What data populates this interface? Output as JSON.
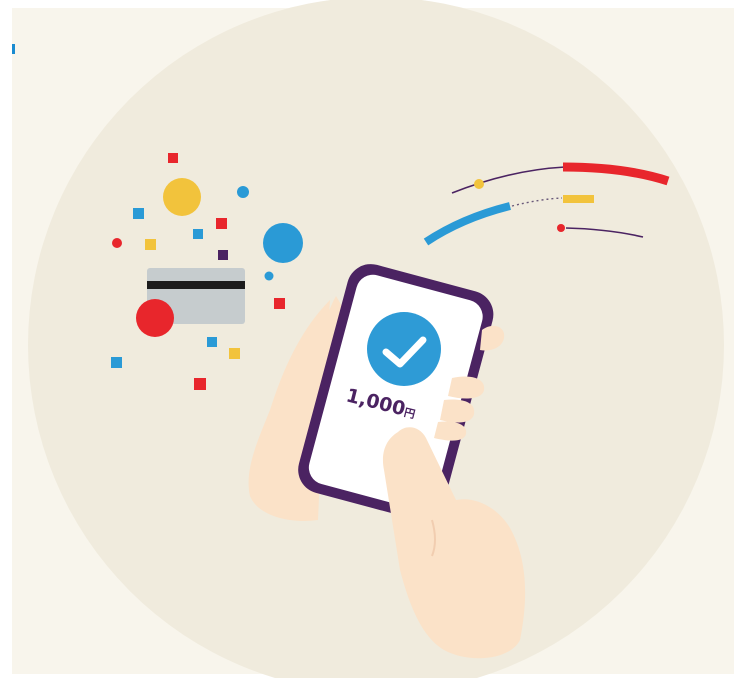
{
  "illustration": {
    "payment_amount": "1,000",
    "currency_unit": "円",
    "status_icon": "check-icon",
    "colors": {
      "background": "#f8f5ec",
      "circle": "#f0ebdd",
      "phone_frame": "#4b2362",
      "check_badge": "#2e9bd6",
      "accent_red": "#e8262c",
      "accent_yellow": "#f2c33c",
      "accent_blue": "#2a9ad6",
      "card": "#c6ccce",
      "skin": "#fbe2c8"
    }
  }
}
